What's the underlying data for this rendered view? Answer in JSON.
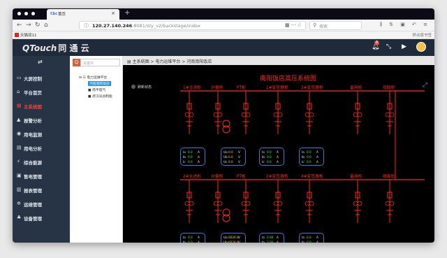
{
  "browser": {
    "tab_title": "首页",
    "tab_favicon": "Cbc",
    "url_host": "120.27.140.246",
    "url_rest": ":8081/sty_v2/backstage/index",
    "search_placeholder": "搜索",
    "bookmark": "天猫双11",
    "bookmark_right": "移动版书签"
  },
  "app": {
    "logo_en": "QTouch",
    "logo_cn": "同 通 云",
    "notification_count": "8"
  },
  "sidebar": {
    "items": [
      {
        "label": "大屏控制",
        "icon": "monitor-icon"
      },
      {
        "label": "平台首页",
        "icon": "home-icon"
      },
      {
        "label": "主系统图",
        "icon": "diagram-icon"
      },
      {
        "label": "报警分析",
        "icon": "bell-icon"
      },
      {
        "label": "用电监测",
        "icon": "eye-icon"
      },
      {
        "label": "用电分析",
        "icon": "chart-icon"
      },
      {
        "label": "综合能源",
        "icon": "energy-icon"
      },
      {
        "label": "售电管理",
        "icon": "cart-icon"
      },
      {
        "label": "报表管理",
        "icon": "report-icon"
      },
      {
        "label": "运维管理",
        "icon": "gear-icon"
      },
      {
        "label": "设备管理",
        "icon": "device-icon"
      }
    ]
  },
  "tree": {
    "search_btn": "Q",
    "search_placeholder": "关键字",
    "root": "电力运维平台",
    "nodes": [
      "河南南阳饭店",
      "南平电气",
      "武汉光谷制能"
    ]
  },
  "breadcrumb": {
    "text": "主系统图 > 电力运维平台 > 河南南阳饭店"
  },
  "diagram": {
    "title": "南阳饭店高压系统图",
    "legend": "刷新状态",
    "row1_labels": [
      "1#主进柜",
      "计量柜",
      "PT柜",
      "1#变压器柜",
      "2#变压器柜",
      "备用柜",
      "母联柜"
    ],
    "row2_labels": [
      "2#主进柜",
      "计量柜",
      "PT柜",
      "2#变压器柜",
      "4#变压器柜",
      "备用柜",
      "隔离柜"
    ],
    "meters_row1": [
      {
        "rows": [
          [
            "Ia",
            "0.0",
            "A"
          ],
          [
            "Ib",
            "0.0",
            "A"
          ],
          [
            "Ic",
            "0.0",
            "A"
          ]
        ],
        "green": true
      },
      {
        "rows": [
          [
            "Ua",
            "0.0",
            "V"
          ],
          [
            "Ub",
            "0.0",
            "V"
          ],
          [
            "Uc",
            "0.0",
            "V"
          ]
        ],
        "green": false
      },
      {
        "rows": [
          [
            "Ia",
            "0.0",
            "A"
          ],
          [
            "Ib",
            "0.0",
            "A"
          ],
          [
            "Ic",
            "0.0",
            "A"
          ]
        ],
        "green": true
      },
      {
        "rows": [
          [
            "Ia",
            "0.0",
            "A"
          ],
          [
            "Ib",
            "0.0",
            "A"
          ],
          [
            "Ic",
            "0.0",
            "A"
          ]
        ],
        "green": true
      }
    ],
    "meters_row2": [
      {
        "rows": [
          [
            "Ia",
            "0.0",
            "A"
          ],
          [
            "Ib",
            "0.0",
            "A"
          ],
          [
            "Ic",
            "0.0",
            "A"
          ]
        ],
        "green": true
      },
      {
        "rows": [
          [
            "Ua",
            "6026.0",
            "V"
          ],
          [
            "Ub",
            "6026.0",
            "V"
          ],
          [
            "Uc",
            "6026.0",
            "V"
          ]
        ],
        "green": false
      },
      {
        "rows": [
          [
            "Ia",
            "2.00",
            "A"
          ],
          [
            "Ib",
            "2.00",
            "A"
          ],
          [
            "Ic",
            "0.00",
            "A"
          ]
        ],
        "green": true
      },
      {
        "rows": [
          [
            "Ia",
            "0.0",
            "A"
          ],
          [
            "Ib",
            "0.0",
            "A"
          ],
          [
            "Ic",
            "0.0",
            "A"
          ]
        ],
        "green": true
      }
    ]
  }
}
